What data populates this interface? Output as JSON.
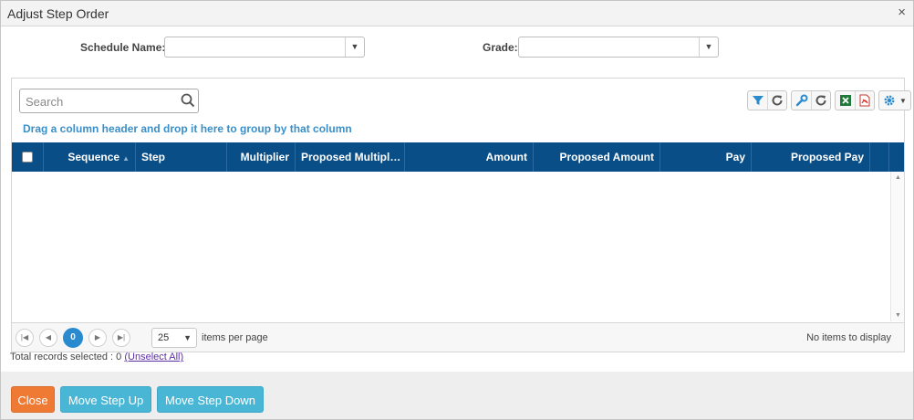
{
  "dialog": {
    "title": "Adjust Step Order",
    "close_glyph": "×"
  },
  "form": {
    "schedule_label": "Schedule Name:",
    "schedule_value": "",
    "grade_label": "Grade:",
    "grade_value": ""
  },
  "grid": {
    "search_placeholder": "Search",
    "group_hint": "Drag a column header and drop it here to group by that column",
    "columns": [
      {
        "label": "Sequence",
        "sorted": "ascending"
      },
      {
        "label": "Step"
      },
      {
        "label": "Multiplier"
      },
      {
        "label": "Proposed Multipl…"
      },
      {
        "label": "Amount"
      },
      {
        "label": "Proposed Amount"
      },
      {
        "label": "Pay"
      },
      {
        "label": "Proposed Pay"
      }
    ],
    "rows": [],
    "toolbar_icons": [
      "filter-icon",
      "refresh-icon",
      "wrench-icon",
      "refresh-icon",
      "excel-icon",
      "pdf-icon",
      "gear-icon"
    ],
    "colors": {
      "header_bg": "#0a4e87",
      "accent": "#2a8ad0",
      "hint": "#3a8fc9"
    }
  },
  "pager": {
    "current_page": "0",
    "page_size": "25",
    "items_per_page_label": "items per page",
    "no_items_label": "No items to display"
  },
  "selection": {
    "prefix": "Total records selected : 0",
    "unselect_label": "(Unselect All)"
  },
  "footer": {
    "close_label": "Close",
    "move_up_label": "Move Step Up",
    "move_down_label": "Move Step Down"
  }
}
